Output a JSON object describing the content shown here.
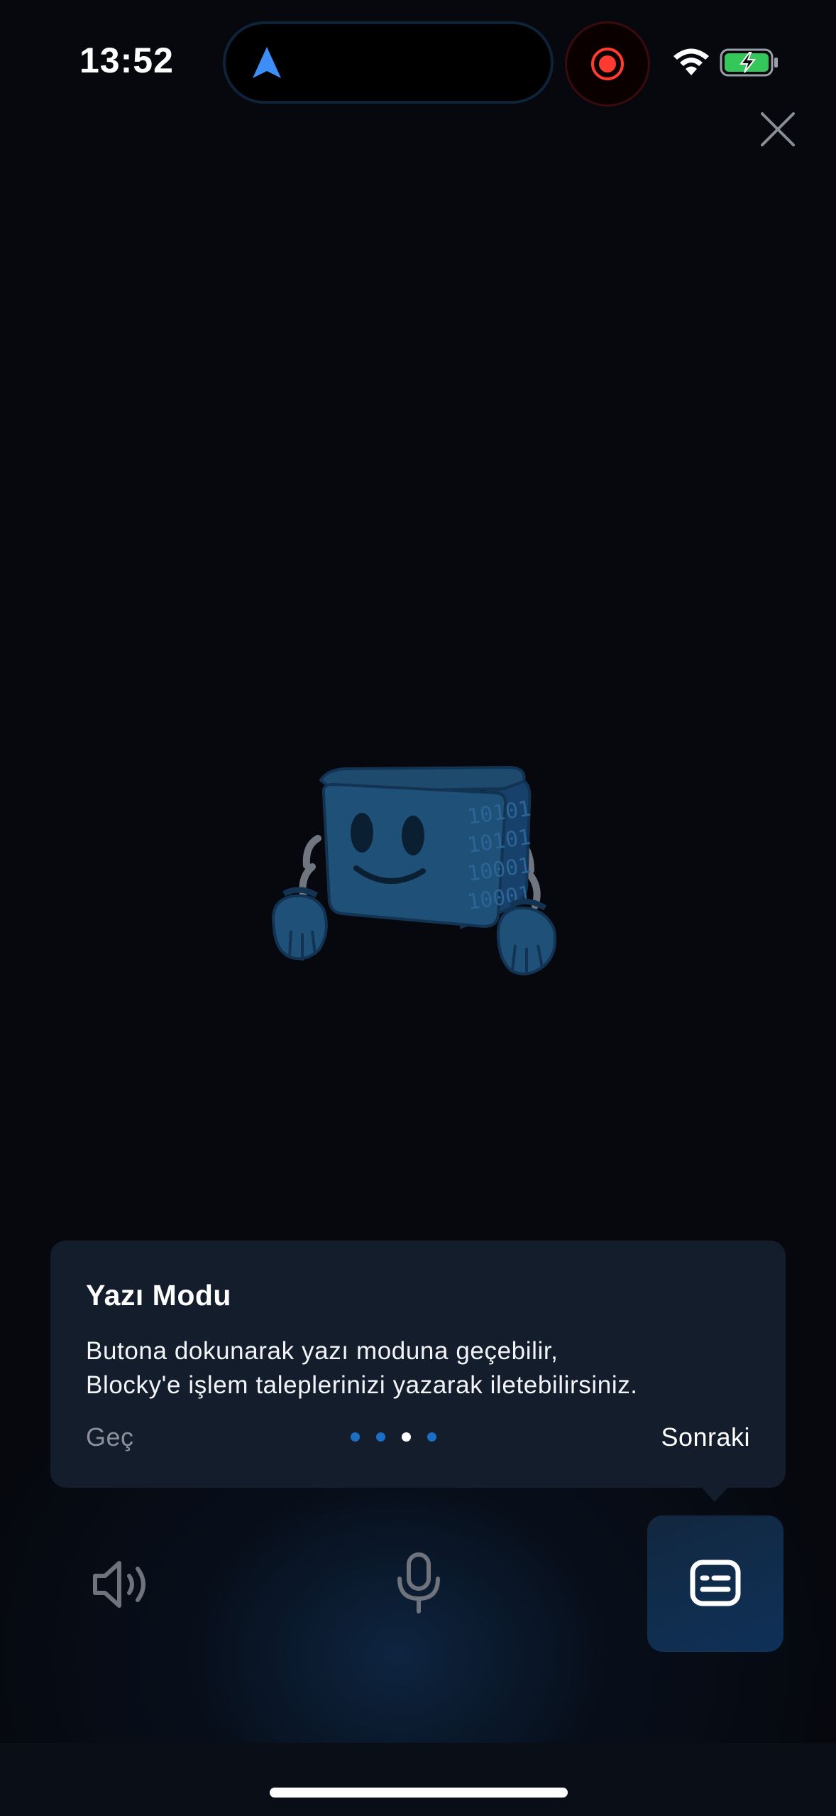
{
  "status_bar": {
    "time": "13:52",
    "icons": [
      "location-arrow-icon",
      "screen-record-icon",
      "wifi-icon",
      "battery-charging-icon"
    ]
  },
  "close_icon": "close-icon",
  "mascot": {
    "name": "Blocky",
    "cube_side_text": [
      "10101",
      "10101",
      "10001",
      "10001"
    ]
  },
  "tooltip": {
    "title": "Yazı Modu",
    "body_line1": "Butona dokunarak yazı moduna geçebilir,",
    "body_line2": "Blocky'e işlem taleplerinizi yazarak iletebilirsiniz.",
    "skip_label": "Geç",
    "next_label": "Sonraki",
    "page_count": 4,
    "current_page": 3
  },
  "controls": {
    "speaker": "speaker-icon",
    "mic": "microphone-icon",
    "text_mode": "keyboard-text-icon"
  },
  "colors": {
    "background": "#06080e",
    "card": "#141d2c",
    "accent": "#1a6fc4",
    "mascot": "#1c4d72",
    "record": "#ff3b30",
    "battery": "#34c759"
  }
}
